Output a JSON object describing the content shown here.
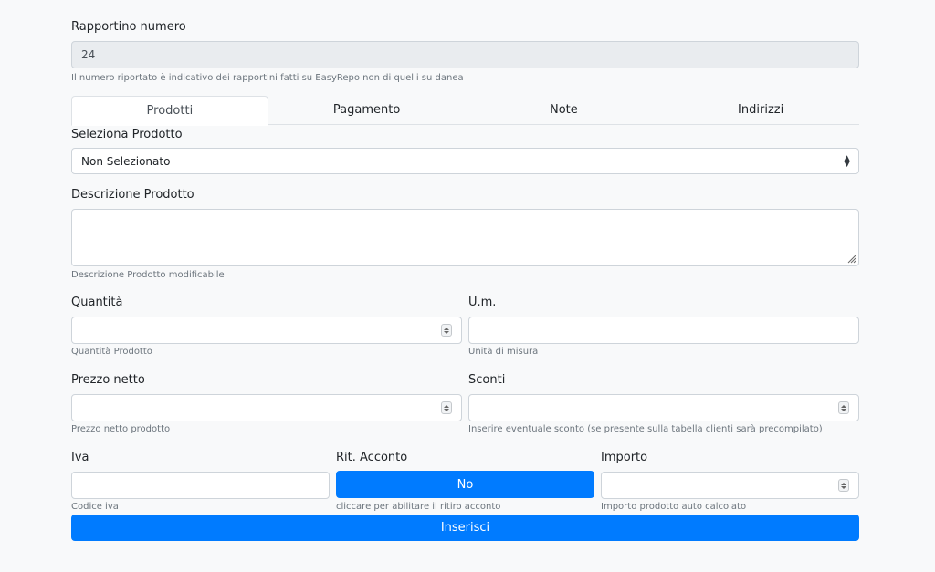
{
  "rapportino": {
    "label": "Rapportino numero",
    "value": "24",
    "help": "Il numero riportato è indicativo dei rapportini fatti su EasyRepo non di quelli su danea"
  },
  "tabs": [
    {
      "label": "Prodotti",
      "active": true
    },
    {
      "label": "Pagamento",
      "active": false
    },
    {
      "label": "Note",
      "active": false
    },
    {
      "label": "Indirizzi",
      "active": false
    }
  ],
  "seleziona": {
    "label": "Seleziona Prodotto",
    "value": "Non Selezionato"
  },
  "descrizione": {
    "label": "Descrizione Prodotto",
    "value": "",
    "help": "Descrizione Prodotto modificabile"
  },
  "quantita": {
    "label": "Quantità",
    "value": "",
    "help": "Quantità Prodotto"
  },
  "um": {
    "label": "U.m.",
    "value": "",
    "help": "Unità di misura"
  },
  "prezzo": {
    "label": "Prezzo netto",
    "value": "",
    "help": "Prezzo netto prodotto"
  },
  "sconti": {
    "label": "Sconti",
    "value": "",
    "help": "Inserire eventuale sconto (se presente sulla tabella clienti sarà precompilato)"
  },
  "iva": {
    "label": "Iva",
    "value": "",
    "help": "Codice iva"
  },
  "ritenuta": {
    "label": "Rit. Acconto",
    "button": "No",
    "help": "cliccare per abilitare il ritiro acconto"
  },
  "importo": {
    "label": "Importo",
    "value": "",
    "help": "Importo prodotto auto calcolato"
  },
  "inserisci": {
    "label": "Inserisci"
  },
  "colors": {
    "primary": "#007bff",
    "readonly_bg": "#e9ecef",
    "page_bg": "#f8f9fa"
  }
}
